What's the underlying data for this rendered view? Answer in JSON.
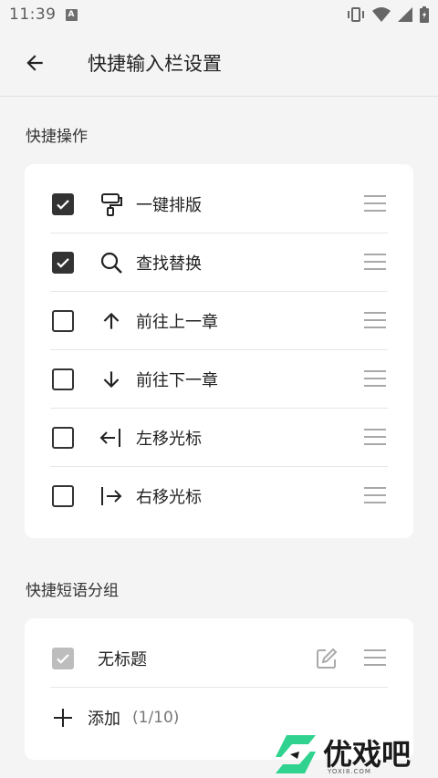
{
  "status_bar": {
    "time": "11:39",
    "notification_badge": "A",
    "icons": [
      "vibrate-icon",
      "wifi-icon",
      "signal-icon",
      "battery-icon"
    ]
  },
  "app_bar": {
    "title": "快捷输入栏设置",
    "back_icon": "arrow-left-icon"
  },
  "quick_actions": {
    "section_title": "快捷操作",
    "items": [
      {
        "label": "一键排版",
        "checked": true,
        "icon": "paint-roller-icon"
      },
      {
        "label": "查找替换",
        "checked": true,
        "icon": "search-icon"
      },
      {
        "label": "前往上一章",
        "checked": false,
        "icon": "arrow-up-icon"
      },
      {
        "label": "前往下一章",
        "checked": false,
        "icon": "arrow-down-icon"
      },
      {
        "label": "左移光标",
        "checked": false,
        "icon": "cursor-left-icon"
      },
      {
        "label": "右移光标",
        "checked": false,
        "icon": "cursor-right-icon"
      }
    ]
  },
  "phrase_groups": {
    "section_title": "快捷短语分组",
    "items": [
      {
        "label": "无标题",
        "checked": true,
        "disabled": true,
        "icon": "edit-icon"
      }
    ],
    "add_label": "添加",
    "add_count": "(1/10)"
  },
  "watermark": {
    "text": "优戏吧",
    "sub": "YOXI8.COM"
  },
  "colors": {
    "background": "#f5f4f4",
    "card": "#ffffff",
    "checkbox": "#333333",
    "checkbox_disabled": "#bdbdbd",
    "watermark_green": "#2fd38f"
  }
}
